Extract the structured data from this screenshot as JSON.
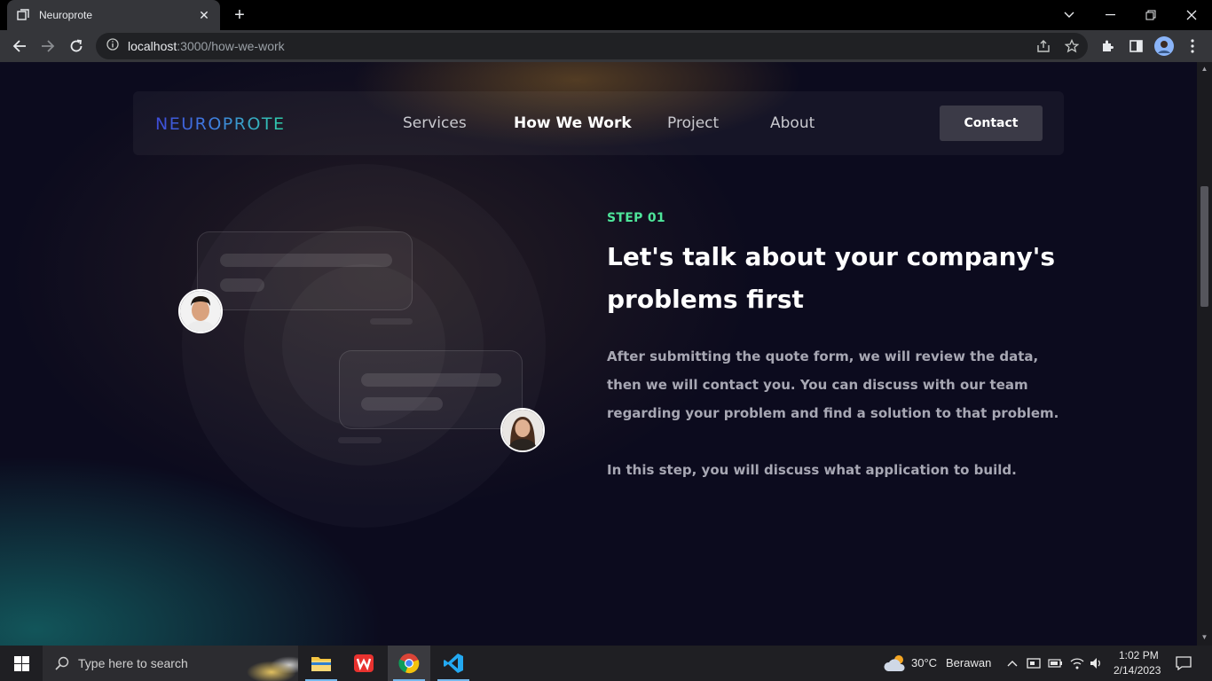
{
  "browser": {
    "tab": {
      "title": "Neuroprote"
    },
    "url": {
      "host": "localhost",
      "rest": ":3000/how-we-work"
    }
  },
  "navbar": {
    "logo": "NEUROPROTE",
    "links": [
      "Services",
      "How We Work",
      "Project",
      "About"
    ],
    "active_link": "How We Work",
    "contact_label": "Contact"
  },
  "step": {
    "label": "STEP 01",
    "heading": "Let's talk about your company's problems first",
    "paragraph": "After submitting the quote form, we will review the data, then we will contact you. You can discuss with our team regarding your problem and find a solution to that problem.",
    "paragraph2": "In this step, you will discuss what application to build."
  },
  "taskbar": {
    "search_placeholder": "Type here to search",
    "weather": {
      "temp": "30°C",
      "condition": "Berawan"
    },
    "clock": {
      "time": "1:02 PM",
      "date": "2/14/2023"
    }
  },
  "colors": {
    "accent_green": "#4ee59a",
    "page_bg": "#0c0b1e",
    "logo_gradient_start": "#3e4bd8",
    "logo_gradient_end": "#2fd0a8"
  }
}
